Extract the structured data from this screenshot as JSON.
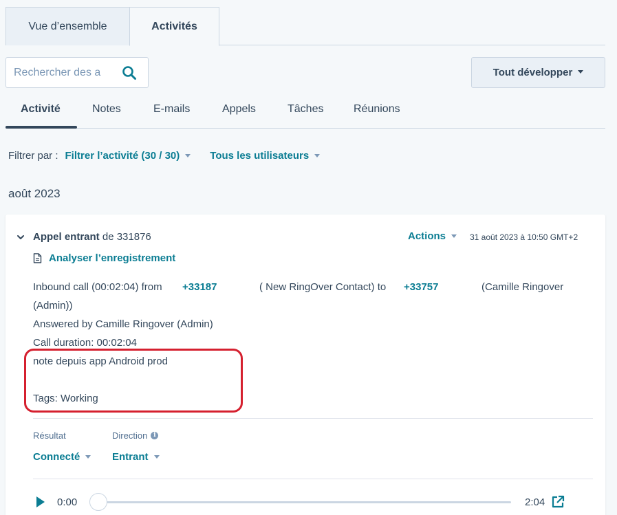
{
  "top_tabs": [
    {
      "label": "Vue d’ensemble"
    },
    {
      "label": "Activités"
    }
  ],
  "search": {
    "placeholder": "Rechercher des a",
    "icon": "search-icon"
  },
  "expand_button": {
    "label": "Tout développer"
  },
  "sub_tabs": [
    {
      "label": "Activité",
      "active": true
    },
    {
      "label": "Notes"
    },
    {
      "label": "E-mails"
    },
    {
      "label": "Appels"
    },
    {
      "label": "Tâches"
    },
    {
      "label": "Réunions"
    }
  ],
  "filter": {
    "label": "Filtrer par :",
    "activity": "Filtrer l’activité (30 / 30)",
    "users": "Tous les utilisateurs"
  },
  "month": "août 2023",
  "card": {
    "title_bold": "Appel entrant",
    "title_rest": "de 331876",
    "actions": "Actions",
    "date": "31 août 2023 à 10:50 GMT+2",
    "analyse": "Analyser l’enregistrement",
    "body": {
      "l1_a": "Inbound call (00:02:04) from",
      "l1_num1": "+33187",
      "l1_b": "( New RingOver Contact) to",
      "l1_num2": "+33757",
      "l1_c": "(Camille Ringover",
      "l2": "(Admin))",
      "l3": "Answered by Camille Ringover (Admin)",
      "l4": "Call duration: 00:02:04",
      "l5": "note depuis app Android prod",
      "l7": "Tags: Working"
    },
    "result_label": "Résultat",
    "result_value": "Connecté",
    "direction_label": "Direction",
    "direction_value": "Entrant",
    "player": {
      "current": "0:00",
      "total": "2:04",
      "progress": 0
    }
  },
  "colors": {
    "accent": "#0b7d93",
    "text": "#33475b",
    "highlight": "#d5202f",
    "background": "#f5f8fa"
  }
}
